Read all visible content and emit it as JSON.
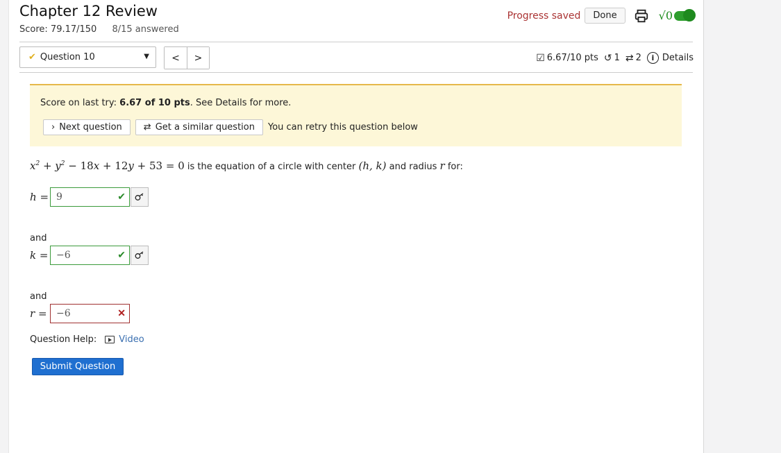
{
  "header": {
    "title": "Chapter 12 Review",
    "score": "Score: 79.17/150",
    "answered": "8/15 answered",
    "progress_saved": "Progress saved",
    "done_label": "Done",
    "sqrt_label": "√0"
  },
  "question_nav": {
    "selected": "Question 10",
    "prev": "<",
    "next": ">"
  },
  "question_meta": {
    "points": "6.67/10 pts",
    "retries": "1",
    "similar": "2",
    "details": "Details"
  },
  "banner": {
    "score_prefix": "Score on last try: ",
    "score_value": "6.67 of 10 pts",
    "score_suffix": ". See Details for more.",
    "next_question": "Next question",
    "similar_question": "Get a similar question",
    "retry_note": "You can retry this question below"
  },
  "question": {
    "tail_text": " is the equation of a circle with center ",
    "and_radius": " and radius ",
    "for_text": " for:",
    "answers": [
      {
        "var": "h",
        "value": "9",
        "status": "correct"
      },
      {
        "var": "k",
        "value": "−6",
        "status": "correct"
      },
      {
        "var": "r",
        "value": "−6",
        "status": "incorrect"
      }
    ],
    "and_label": "and"
  },
  "help": {
    "label": "Question Help:",
    "video": "Video"
  },
  "submit_label": "Submit Question",
  "colors": {
    "banner_bg": "#fdf7d8",
    "correct": "#2a8a2a",
    "incorrect": "#b02020",
    "submit": "#1f6fd0"
  }
}
